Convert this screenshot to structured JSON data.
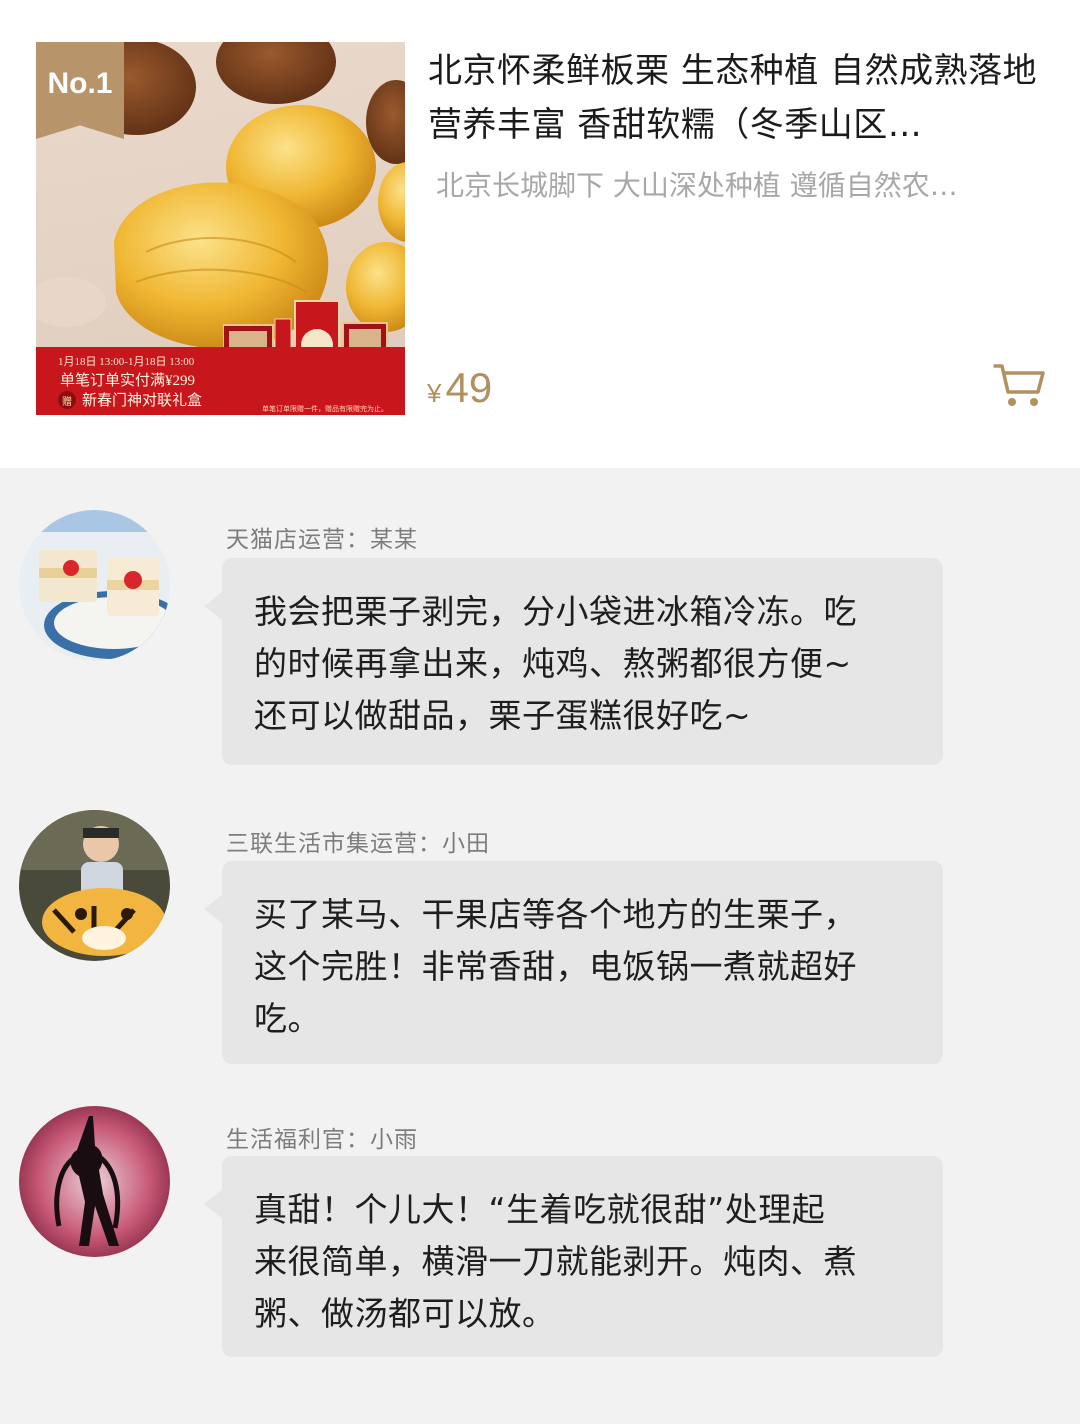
{
  "product": {
    "badge": "No.1",
    "title": "北京怀柔鲜板栗 生态种植 自然成熟落地 营养丰富 香甜软糯（冬季山区…",
    "subtitle": "北京长城脚下 大山深处种植 遵循自然农…",
    "price_currency": "¥",
    "price_value": "49",
    "promo": {
      "date": "1月18日 13:00-1月18日 13:00",
      "line1": "单笔订单实付满¥299",
      "zeng": "赠",
      "line2": "新春门神对联礼盒",
      "small": "单笔订单限赠一件，赠品有限赠完为止。"
    },
    "cart_icon": "cart-icon"
  },
  "comments": [
    {
      "author": "天猫店运营：某某",
      "avatar": "avatar-cakes",
      "text": "我会把栗子剥完，分小袋进冰箱冷冻。吃\n的时候再拿出来，炖鸡、熬粥都很方便~\n还可以做甜品，栗子蛋糕很好吃~"
    },
    {
      "author": "三联生活市集运营：小田",
      "avatar": "avatar-child-tiger",
      "text": "买了某马、干果店等各个地方的生栗子，\n这个完胜！非常香甜，电饭锅一煮就超好\n吃。"
    },
    {
      "author": "生活福利官：小雨",
      "avatar": "avatar-silhouette",
      "text": "真甜！个儿大！“生着吃就很甜”处理起\n来很简单，横滑一刀就能剥开。炖肉、煮\n粥、做汤都可以放。"
    }
  ],
  "colors": {
    "accent_gold": "#b0915f",
    "badge_bg": "#b8946a",
    "promo_red": "#c8161d",
    "bubble_bg": "#e6e6e6",
    "page_bg": "#f2f2f2"
  }
}
